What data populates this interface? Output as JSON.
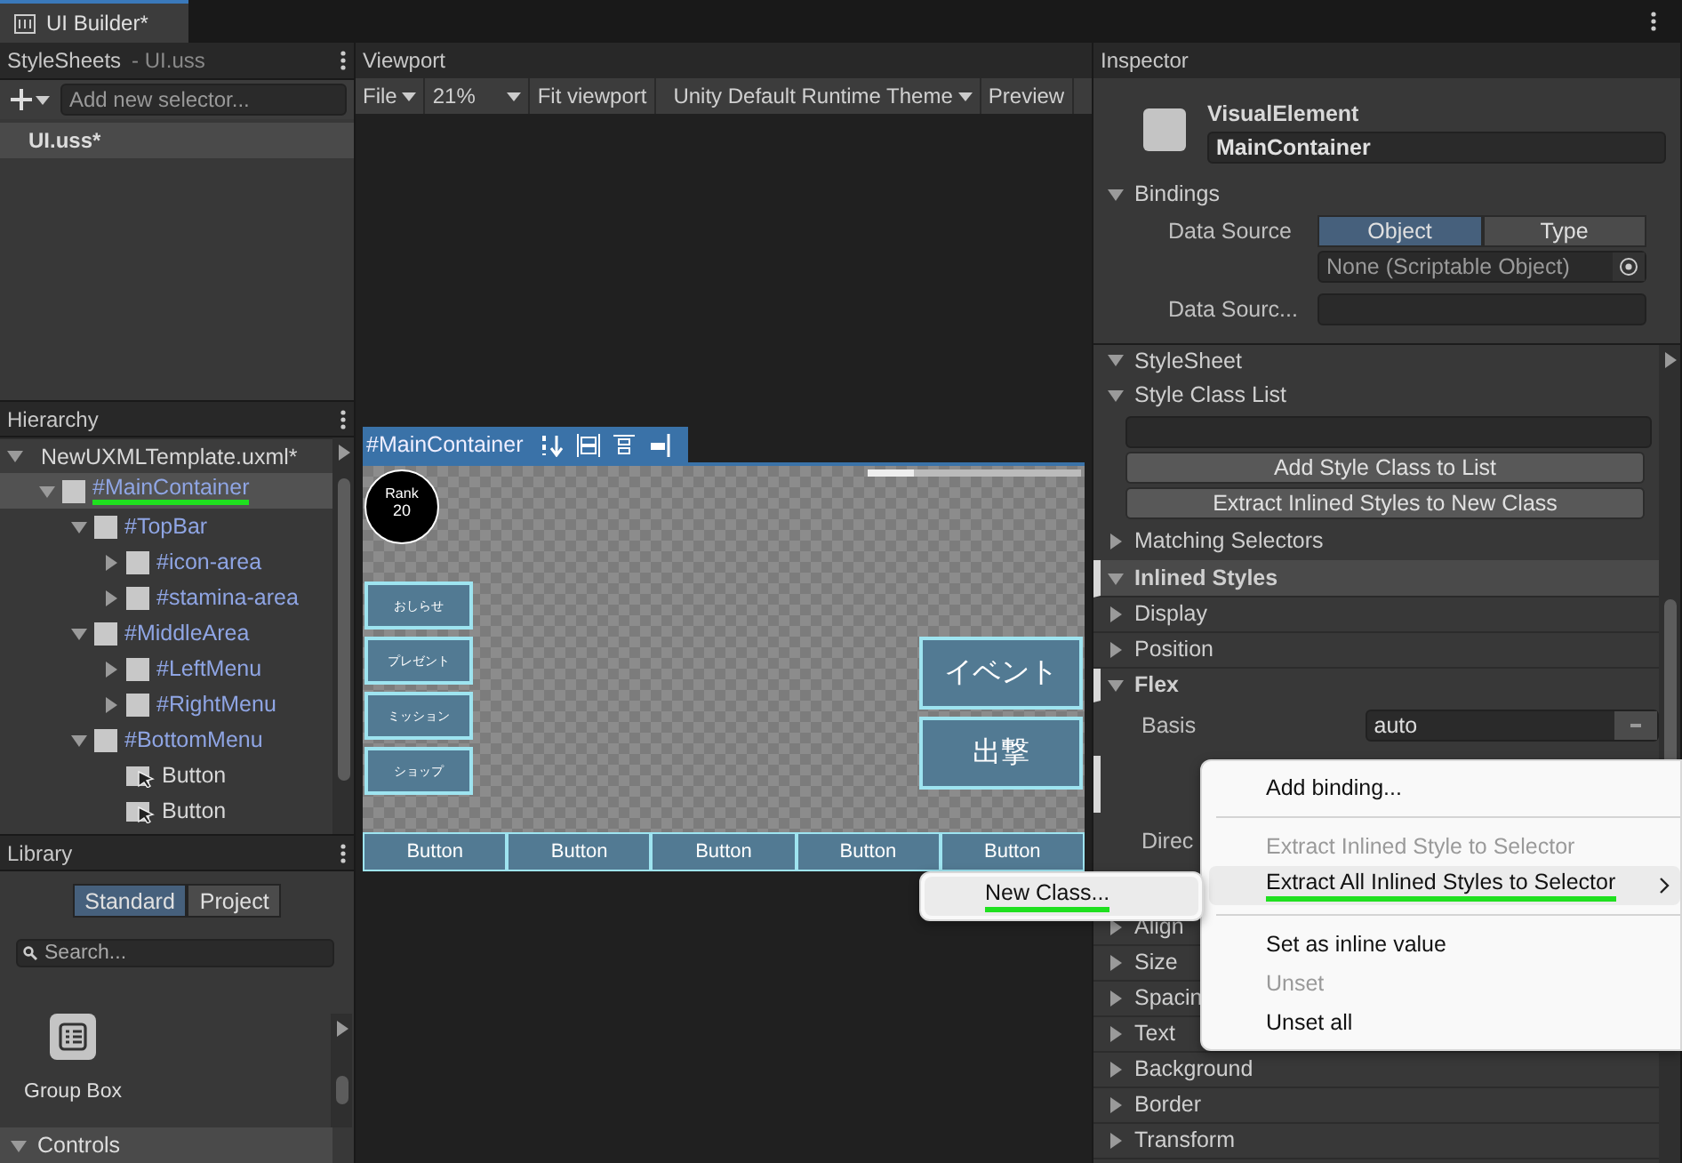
{
  "tab": {
    "title": "UI Builder*"
  },
  "stylesheets": {
    "title": "StyleSheets",
    "subtitle": "- UI.uss",
    "selector_placeholder": "Add new selector...",
    "files": [
      {
        "name": "UI.uss*",
        "selected": true
      }
    ]
  },
  "hierarchy": {
    "title": "Hierarchy",
    "tree": [
      {
        "label": "NewUXMLTemplate.uxml*",
        "kind": "document",
        "expanded": true,
        "selected": false,
        "underlined": false,
        "children": [
          {
            "label": "#MainContainer",
            "kind": "element",
            "expanded": true,
            "selected": true,
            "underlined": true,
            "children": [
              {
                "label": "#TopBar",
                "kind": "element",
                "expanded": true,
                "selected": false,
                "underlined": false,
                "children": [
                  {
                    "label": "#icon-area",
                    "kind": "element",
                    "expanded": false,
                    "selected": false,
                    "underlined": false
                  },
                  {
                    "label": "#stamina-area",
                    "kind": "element",
                    "expanded": false,
                    "selected": false,
                    "underlined": false
                  }
                ]
              },
              {
                "label": "#MiddleArea",
                "kind": "element",
                "expanded": true,
                "selected": false,
                "underlined": false,
                "children": [
                  {
                    "label": "#LeftMenu",
                    "kind": "element",
                    "expanded": false,
                    "selected": false,
                    "underlined": false
                  },
                  {
                    "label": "#RightMenu",
                    "kind": "element",
                    "expanded": false,
                    "selected": false,
                    "underlined": false
                  }
                ]
              },
              {
                "label": "#BottomMenu",
                "kind": "element",
                "expanded": true,
                "selected": false,
                "underlined": false,
                "children": [
                  {
                    "label": "Button",
                    "kind": "button",
                    "selected": false,
                    "underlined": false
                  },
                  {
                    "label": "Button",
                    "kind": "button",
                    "selected": false,
                    "underlined": false
                  }
                ]
              }
            ]
          }
        ]
      }
    ]
  },
  "library": {
    "title": "Library",
    "tabs": [
      {
        "label": "Standard",
        "selected": true
      },
      {
        "label": "Project",
        "selected": false
      }
    ],
    "search_placeholder": "Search...",
    "items": [
      {
        "label": "Group Box"
      }
    ],
    "sections": [
      {
        "label": "Controls",
        "expanded": true
      }
    ]
  },
  "viewport": {
    "title": "Viewport",
    "toolbar": [
      {
        "label": "File",
        "kind": "menu"
      },
      {
        "label": "21%",
        "kind": "dropdown"
      },
      {
        "label": "Fit viewport",
        "kind": "button"
      },
      {
        "label": "Unity Default Runtime Theme",
        "kind": "menu"
      },
      {
        "label": "Preview",
        "kind": "button"
      }
    ],
    "canvas": {
      "selection_label": "#MainContainer",
      "rank": {
        "label": "Rank",
        "value": "20"
      },
      "left_menu": [
        "おしらせ",
        "プレゼント",
        "ミッション",
        "ショップ"
      ],
      "right_menu": [
        "イベント",
        "出撃"
      ],
      "bottom_menu": [
        "Button",
        "Button",
        "Button",
        "Button",
        "Button"
      ]
    }
  },
  "inspector": {
    "title": "Inspector",
    "element": {
      "type": "VisualElement",
      "name": "MainContainer"
    },
    "bindings": {
      "label": "Bindings",
      "expanded": true,
      "data_source_label": "Data Source",
      "modes": [
        {
          "label": "Object",
          "selected": true
        },
        {
          "label": "Type",
          "selected": false
        }
      ],
      "object_field": "None (Scriptable Object)",
      "path_label": "Data Sourc..."
    },
    "sections": [
      {
        "label": "StyleSheet",
        "expanded": true,
        "kind": "section"
      },
      {
        "label": "Style Class List",
        "expanded": true,
        "kind": "class_list",
        "buttons": [
          "Add Style Class to List",
          "Extract Inlined Styles to New Class"
        ]
      },
      {
        "label": "Matching Selectors",
        "expanded": false,
        "kind": "section"
      },
      {
        "label": "Inlined Styles",
        "expanded": true,
        "kind": "header"
      }
    ],
    "style_groups": [
      {
        "label": "Display",
        "expanded": false,
        "overridden": false
      },
      {
        "label": "Position",
        "expanded": false,
        "overridden": false
      },
      {
        "label": "Flex",
        "expanded": true,
        "overridden": true,
        "rows": [
          {
            "label": "Basis",
            "value": "auto"
          },
          {
            "label": "Direc"
          }
        ]
      },
      {
        "label": "Align",
        "expanded": false,
        "overridden": false
      },
      {
        "label": "Size",
        "expanded": false,
        "overridden": false
      },
      {
        "label": "Spacin",
        "expanded": false,
        "overridden": false
      },
      {
        "label": "Text",
        "expanded": false,
        "overridden": false
      },
      {
        "label": "Background",
        "expanded": false,
        "overridden": false
      },
      {
        "label": "Border",
        "expanded": false,
        "overridden": false
      },
      {
        "label": "Transform",
        "expanded": false,
        "overridden": false
      }
    ]
  },
  "context_menu": {
    "items": [
      {
        "kind": "item",
        "label": "Add binding...",
        "disabled": false,
        "highlighted": false,
        "submenu": false,
        "underlined": false
      },
      {
        "kind": "separator"
      },
      {
        "kind": "item",
        "label": "Extract Inlined Style to Selector",
        "disabled": true,
        "highlighted": false,
        "submenu": false,
        "underlined": false
      },
      {
        "kind": "item",
        "label": "Extract All Inlined Styles to Selector",
        "disabled": false,
        "highlighted": true,
        "submenu": true,
        "underlined": true
      },
      {
        "kind": "separator"
      },
      {
        "kind": "item",
        "label": "Set as inline value",
        "disabled": false,
        "highlighted": false,
        "submenu": false,
        "underlined": false
      },
      {
        "kind": "item",
        "label": "Unset",
        "disabled": true,
        "highlighted": false,
        "submenu": false,
        "underlined": false
      },
      {
        "kind": "item",
        "label": "Unset all",
        "disabled": false,
        "highlighted": false,
        "submenu": false,
        "underlined": false
      }
    ],
    "submenu": [
      {
        "label": "New Class...",
        "highlighted": true,
        "underlined": true
      }
    ]
  }
}
